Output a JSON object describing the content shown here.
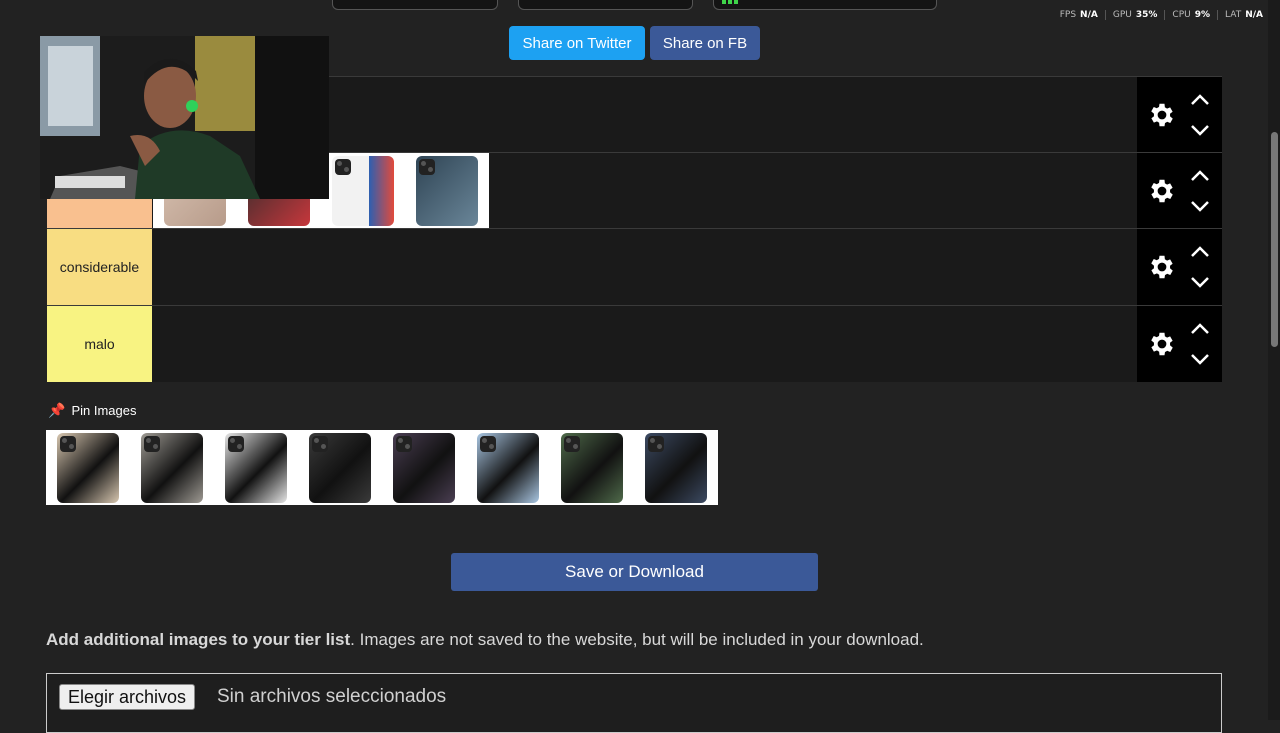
{
  "perf": [
    {
      "label": "FPS",
      "value": "N/A"
    },
    {
      "label": "GPU",
      "value": "35",
      "unit": "%"
    },
    {
      "label": "CPU",
      "value": "9",
      "unit": "%"
    },
    {
      "label": "LAT",
      "value": "N/A"
    }
  ],
  "share": {
    "twitter": "Share on Twitter",
    "facebook": "Share on FB"
  },
  "tiers": [
    {
      "label": "",
      "color": "#1a1a1a"
    },
    {
      "label": "",
      "color": "#f9c08f"
    },
    {
      "label": "considerable",
      "color": "#f8dd82"
    },
    {
      "label": "malo",
      "color": "#f8f382"
    }
  ],
  "pin": {
    "label": "Pin Images",
    "icon": "pushpin-icon"
  },
  "pin_images": [
    {
      "name": "phone-gold",
      "color": "#d8c7b0"
    },
    {
      "name": "phone-natural-titanium",
      "color": "#9e9a93"
    },
    {
      "name": "phone-silver",
      "color": "#e6e6e6"
    },
    {
      "name": "phone-space-black",
      "color": "#3a3a3a"
    },
    {
      "name": "phone-deep-purple",
      "color": "#4a3e52"
    },
    {
      "name": "phone-sierra-blue",
      "color": "#a9c6e2"
    },
    {
      "name": "phone-alpine-green",
      "color": "#4f6a4a"
    },
    {
      "name": "phone-blue-titanium",
      "color": "#3c4a62"
    }
  ],
  "save_button": "Save or Download",
  "add_images": {
    "bold": "Add additional images to your tier list",
    "rest": ". Images are not saved to the website, but will be included in your download."
  },
  "file_input": {
    "button": "Elegir archivos",
    "status": "Sin archivos seleccionados"
  }
}
